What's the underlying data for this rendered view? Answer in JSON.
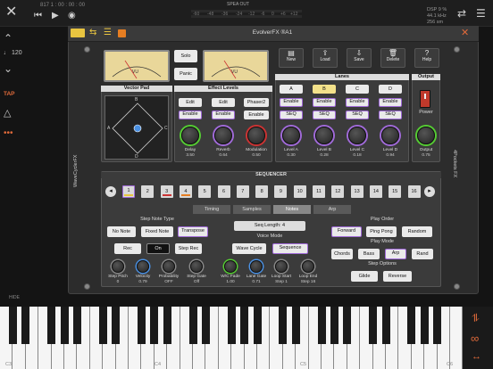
{
  "topbar": {
    "position": "817 1 : 00 : 00 : 00",
    "meter_title": "SPEA OUT",
    "meter_scale": [
      "-60",
      "-48",
      "-36",
      "-24",
      "-12",
      "-6",
      "0",
      "+6",
      "+12"
    ],
    "dsp_label": "DSP",
    "dsp_value": "9 %",
    "sr": "44.1 kHz",
    "bs": "256 sm"
  },
  "left": {
    "bpm": "120",
    "tap": "TAP",
    "hide": "HIDE"
  },
  "title": "EvolverFX ®A1",
  "toolbar": [
    "New",
    "Load",
    "Save",
    "Delete",
    "Help"
  ],
  "solo": "Solo",
  "panic": "Panic",
  "vu": {
    "left": "VU",
    "right": "VU"
  },
  "vector_pad": {
    "title": "Vector Pad",
    "labels": [
      "B",
      "A",
      "C",
      "D"
    ]
  },
  "effect_levels": {
    "title": "Effect Levels",
    "edit": [
      "Edit",
      "Edit",
      "Phaser2"
    ],
    "enable": [
      "Enable",
      "Enable",
      "Enable"
    ],
    "knobs": [
      {
        "name": "Delay",
        "value": "3.50"
      },
      {
        "name": "Reverb",
        "value": "0.64"
      },
      {
        "name": "Modulation",
        "value": "0.50"
      }
    ]
  },
  "lanes": {
    "title": "Lanes",
    "names": [
      "A",
      "B",
      "C",
      "D"
    ],
    "enable": "Enable",
    "seq": "SEQ",
    "knobs": [
      {
        "name": "Level A",
        "value": "0.30"
      },
      {
        "name": "Level B",
        "value": "0.28"
      },
      {
        "name": "Level C",
        "value": "0.18"
      },
      {
        "name": "Level D",
        "value": "0.94"
      }
    ]
  },
  "output": {
    "title": "Output",
    "power": "Power",
    "knob": {
      "name": "Output",
      "value": "0.75"
    }
  },
  "side_left": "WaveCyclerFX",
  "side_right": "4Pockets FX",
  "sequencer": {
    "title": "SEQUENCER",
    "steps": [
      "1",
      "2",
      "3",
      "4",
      "5",
      "6",
      "7",
      "8",
      "9",
      "10",
      "11",
      "12",
      "13",
      "14",
      "15",
      "16"
    ],
    "tabs": [
      "Timing",
      "Samples",
      "Notes",
      "Arp"
    ],
    "selected_tab": "Notes",
    "step_note_type_label": "Step Note Type",
    "step_note_types": [
      "No Note",
      "Fixed Note",
      "Transpose"
    ],
    "rec": "Rec",
    "on": "On",
    "step_rec": "Step Rec",
    "seq_length": "Seq Length: 4",
    "voice_mode_label": "Voice Mode",
    "voice_modes": [
      "Wave Cycle",
      "Sequence"
    ],
    "play_order_label": "Play Order",
    "play_orders": [
      "Forward",
      "Ping Pong",
      "Random"
    ],
    "play_mode_label": "Play Mode",
    "play_modes": [
      "Chords",
      "Bass",
      "Arp",
      "Rand"
    ],
    "step_options_label": "Step Options",
    "step_options": [
      "Glide",
      "Reverse"
    ],
    "knobs": [
      {
        "name": "Step Pitch",
        "value": "0"
      },
      {
        "name": "Velocity",
        "value": "0.79"
      },
      {
        "name": "Probability",
        "value": "OFF"
      },
      {
        "name": "Step Gate",
        "value": "Off"
      },
      {
        "name": "W/C Fade",
        "value": "1.00"
      },
      {
        "name": "Lane Gate",
        "value": "0.71"
      },
      {
        "name": "Loop Start",
        "value": "Step 1"
      },
      {
        "name": "Loop End",
        "value": "Step 16"
      }
    ]
  },
  "keyboard": {
    "labels": [
      "C3",
      "C4",
      "C5",
      "C6"
    ]
  }
}
